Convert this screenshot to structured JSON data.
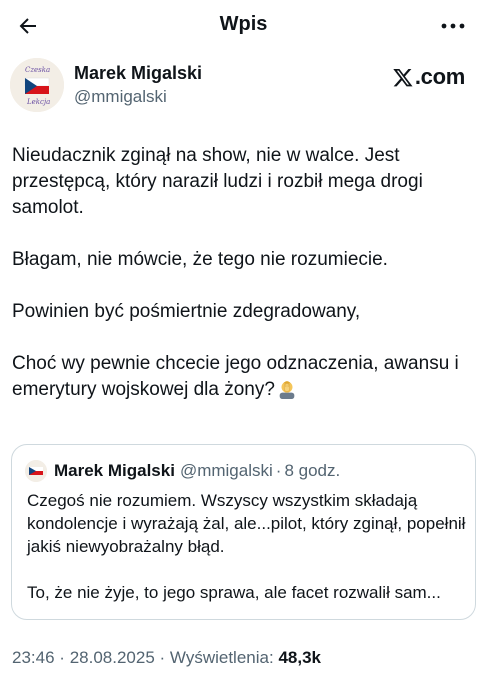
{
  "header": {
    "title": "Wpis"
  },
  "author": {
    "name": "Marek Migalski",
    "handle": "@mmigalski",
    "avatar_text": [
      "Czeska",
      "Lekcja"
    ]
  },
  "brand": {
    "label": ".com"
  },
  "tweet": {
    "paragraphs": [
      "Nieudacznik zginął na show, nie w walce. Jest przestępcą, który naraził ludzi i rozbił mega drogi samolot.",
      "Błagam, nie mówcie, że tego nie rozumiecie.",
      "Powinien być pośmiertnie zdegradowany,",
      "Choć wy pewnie chcecie jego odznaczenia, awansu i emerytury wojskowej dla żony?"
    ],
    "emoji": "man-facepalming-emoji"
  },
  "quote": {
    "name": "Marek Migalski",
    "handle": "@mmigalski",
    "separator": "·",
    "time": "8 godz.",
    "paragraphs": [
      "Czegoś nie rozumiem. Wszyscy wszystkim składają kondolencje i wyrażają żal, ale...pilot, który zginął, popełnił jakiś niewyobrażalny błąd.",
      "To, że nie żyje, to jego sprawa, ale facet rozwalił sam..."
    ]
  },
  "footer": {
    "time": "23:46",
    "sep1": "·",
    "date": "28.08.2025",
    "sep2": "·",
    "views_label": "Wyświetlenia:",
    "views_count": "48,3k"
  },
  "colors": {
    "text": "#0f1419",
    "secondary": "#536471",
    "border": "#cfd9de",
    "flag_red": "#d7141a",
    "flag_blue": "#11457e"
  }
}
